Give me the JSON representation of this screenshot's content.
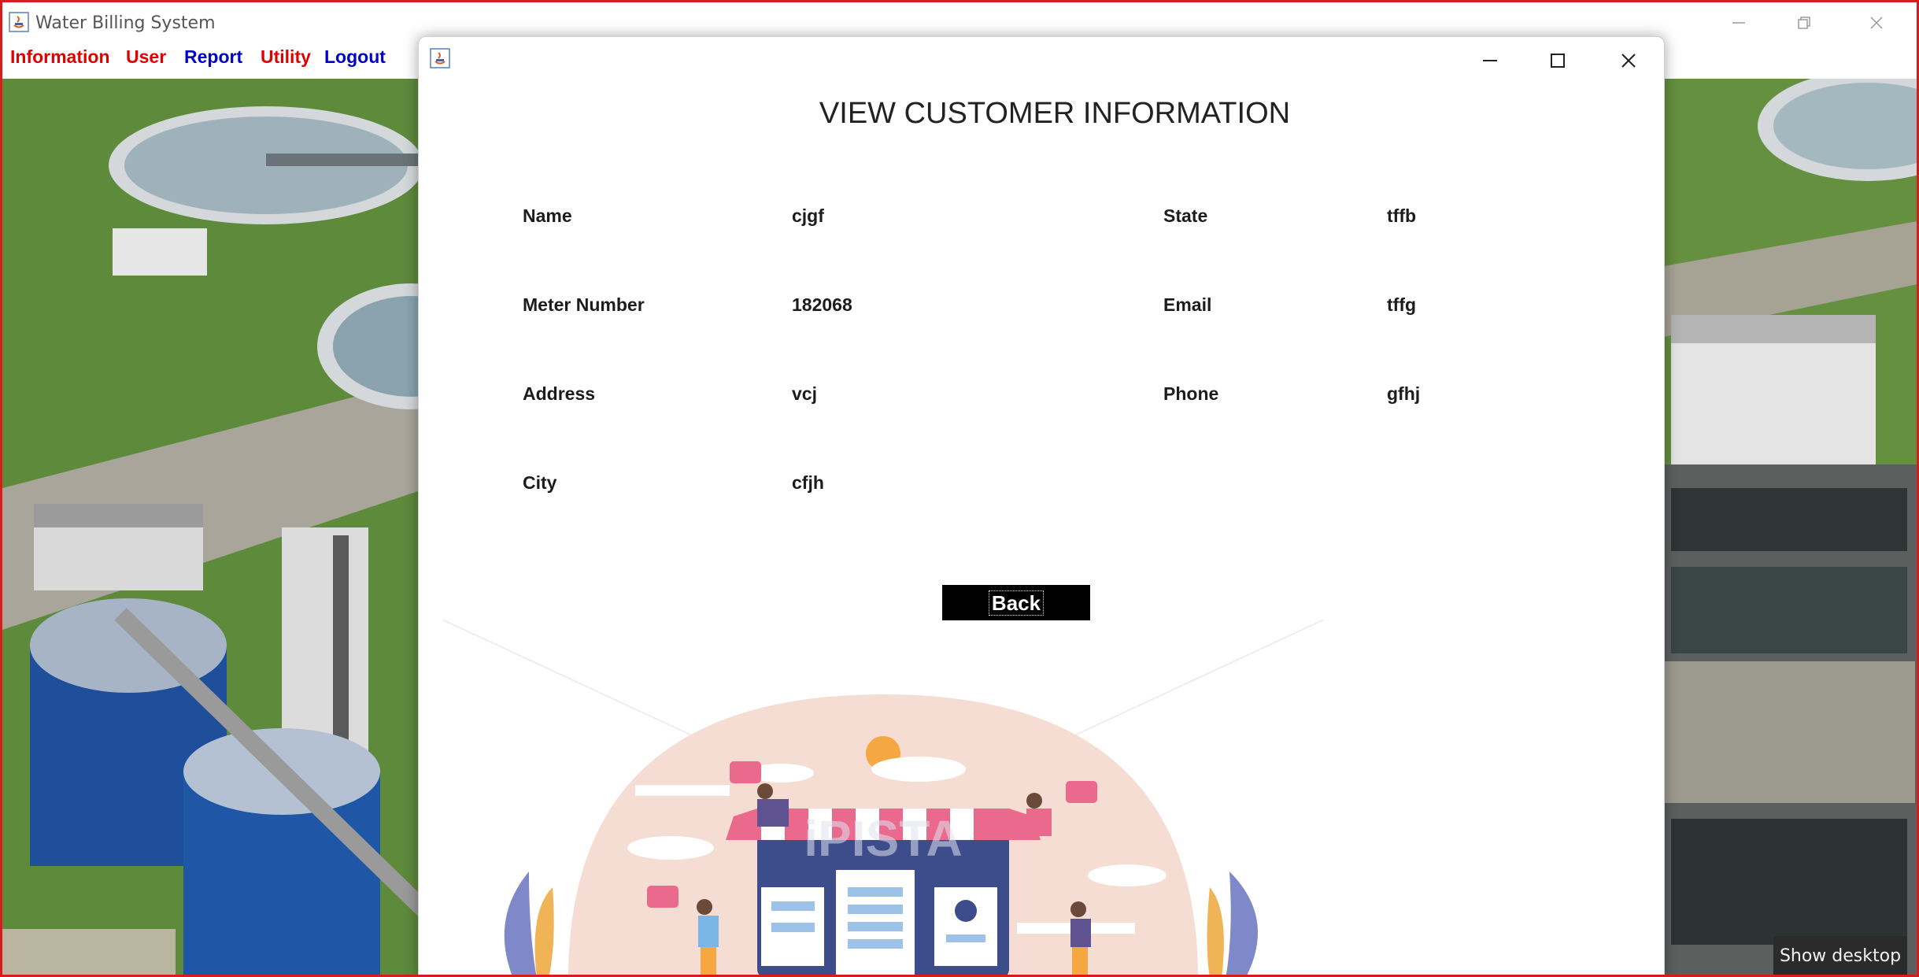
{
  "main_window": {
    "title": "Water Billing System",
    "menu": [
      {
        "label": "Information",
        "color": "#e00000"
      },
      {
        "label": "User",
        "color": "#e00000"
      },
      {
        "label": "Report",
        "color": "#0000c8"
      },
      {
        "label": "Utility",
        "color": "#e00000"
      },
      {
        "label": "Logout",
        "color": "#0000c8"
      }
    ]
  },
  "dialog": {
    "heading": "VIEW CUSTOMER INFORMATION",
    "left_fields": [
      {
        "label": "Name",
        "value": "cjgf"
      },
      {
        "label": "Meter Number",
        "value": "182068"
      },
      {
        "label": "Address",
        "value": "vcj"
      },
      {
        "label": "City",
        "value": "cfjh"
      }
    ],
    "right_fields": [
      {
        "label": "State",
        "value": "tffb"
      },
      {
        "label": "Email",
        "value": "tffg"
      },
      {
        "label": "Phone",
        "value": "gfhj"
      }
    ],
    "back_button": "Back",
    "illustration_watermark": "iPISTA"
  },
  "taskbar": {
    "show_desktop": "Show desktop"
  },
  "colors": {
    "frame_border": "#d81b1b",
    "menu_red": "#e00000",
    "menu_blue": "#0000c8",
    "back_button_bg": "#000000"
  }
}
